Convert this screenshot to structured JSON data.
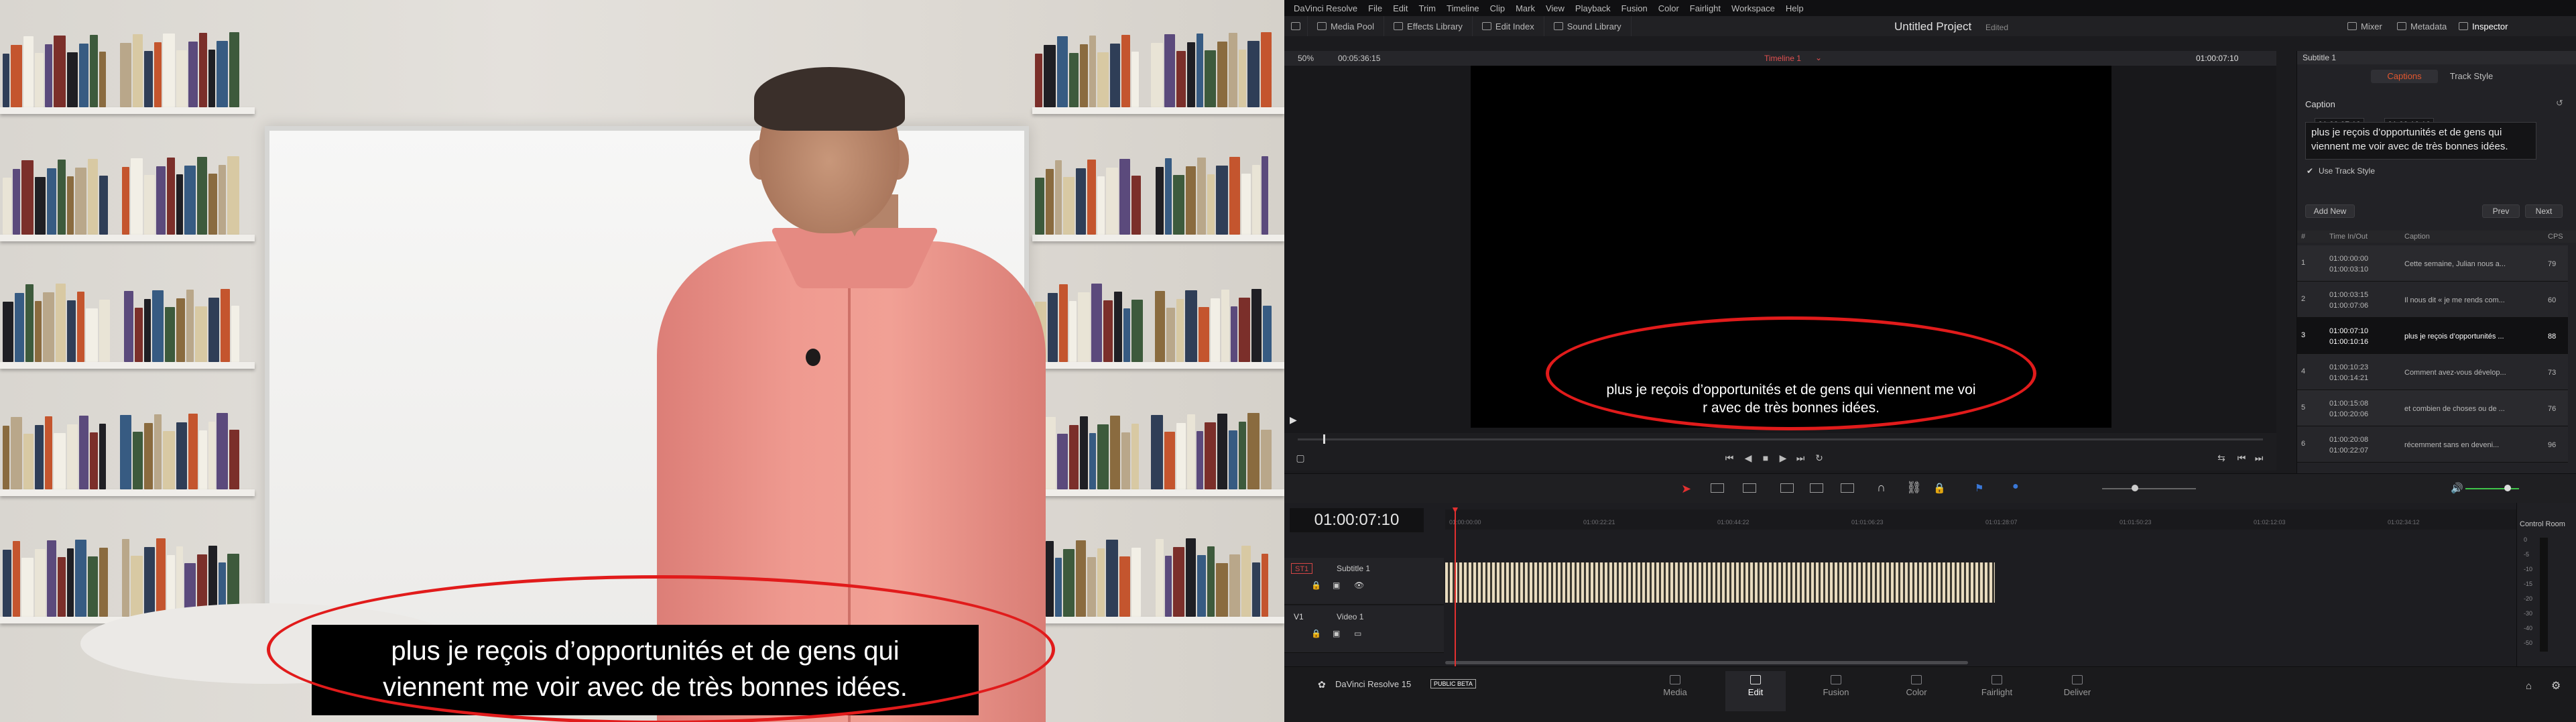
{
  "left_video": {
    "subtitle_line1": "plus je reçois d’opportunités et de gens qui",
    "subtitle_line2": "viennent me voir avec de très bonnes idées."
  },
  "colors": {
    "highlight_ring": "#e11b1b",
    "accent_red": "#e33030",
    "caption_tab": "#e2572f"
  },
  "menu": [
    "DaVinci Resolve",
    "File",
    "Edit",
    "Trim",
    "Timeline",
    "Clip",
    "Mark",
    "View",
    "Playback",
    "Fusion",
    "Color",
    "Fairlight",
    "Workspace",
    "Help"
  ],
  "toolbar": {
    "media_pool": "Media Pool",
    "effects_library": "Effects Library",
    "edit_index": "Edit Index",
    "sound_library": "Sound Library",
    "project_title": "Untitled Project",
    "project_status": "Edited",
    "mixer": "Mixer",
    "metadata": "Metadata",
    "inspector": "Inspector"
  },
  "viewer": {
    "zoom": "50%",
    "duration": "00:05:36:15",
    "timeline_name": "Timeline 1",
    "timecode": "01:00:07:10",
    "subtitle_line1": "plus je reçois d’opportunités et de gens qui viennent me voi",
    "subtitle_line2": "r avec de très bonnes idées."
  },
  "inspector": {
    "header": "Subtitle 1",
    "tab_captions": "Captions",
    "tab_track_style": "Track Style",
    "section": "Caption",
    "tc_in": "01:00:07:10",
    "tc_out": "01:00:10:16",
    "caption_text_line1": "plus je reçois d’opportunités et de gens qui",
    "caption_text_line2": "viennent me voir avec de très bonnes idées.",
    "use_track_style": "Use Track Style",
    "add_new": "Add New",
    "prev": "Prev",
    "next": "Next",
    "table_headers": {
      "num": "#",
      "time": "Time In/Out",
      "caption": "Caption",
      "cps": "CPS"
    },
    "rows": [
      {
        "num": "1",
        "tin": "01:00:00:00",
        "tout": "01:00:03:10",
        "caption": "Cette semaine, Julian nous a...",
        "cps": "79"
      },
      {
        "num": "2",
        "tin": "01:00:03:15",
        "tout": "01:00:07:06",
        "caption": "Il nous dit « je me rends com...",
        "cps": "60"
      },
      {
        "num": "3",
        "tin": "01:00:07:10",
        "tout": "01:00:10:16",
        "caption": "plus je reçois d’opportunités ...",
        "cps": "88"
      },
      {
        "num": "4",
        "tin": "01:00:10:23",
        "tout": "01:00:14:21",
        "caption": "Comment avez-vous dévelop...",
        "cps": "73"
      },
      {
        "num": "5",
        "tin": "01:00:15:08",
        "tout": "01:00:20:06",
        "caption": "et combien de choses ou de ...",
        "cps": "76"
      },
      {
        "num": "6",
        "tin": "01:00:20:08",
        "tout": "01:00:22:07",
        "caption": "récemment sans en deveni...",
        "cps": "96"
      }
    ]
  },
  "timeline": {
    "timecode": "01:00:07:10",
    "ruler": [
      "01:00:00:00",
      "01:00:22:21",
      "01:00:44:22",
      "01:01:06:23",
      "01:01:28:07",
      "01:01:50:23",
      "01:02:12:03",
      "01:02:34:12"
    ],
    "tracks": [
      {
        "tag": "ST1",
        "name": "Subtitle 1"
      },
      {
        "tag": "V1",
        "name": "Video 1"
      }
    ],
    "control_room": "Control Room",
    "meter_scale": [
      "0",
      "-5",
      "-10",
      "-15",
      "-20",
      "-30",
      "-40",
      "-50"
    ]
  },
  "pagebar": {
    "app": "DaVinci Resolve 15",
    "badge": "PUBLIC BETA",
    "pages": [
      "Media",
      "Edit",
      "Fusion",
      "Color",
      "Fairlight",
      "Deliver"
    ],
    "active_page": "Edit"
  }
}
